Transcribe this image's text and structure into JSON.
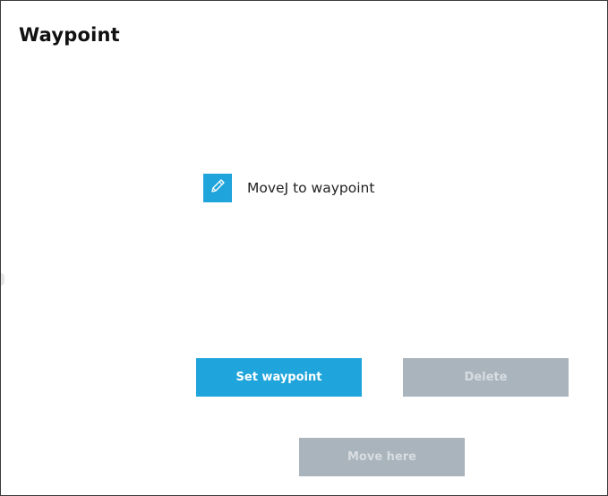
{
  "header": {
    "title": "Waypoint"
  },
  "waypoint": {
    "edit_icon": "pencil-icon",
    "label": "MoveJ to waypoint"
  },
  "buttons": {
    "set_waypoint": "Set waypoint",
    "delete": "Delete",
    "move_here": "Move here"
  },
  "colors": {
    "accent": "#1fa4db",
    "disabled": "#a9b4bd",
    "disabled_text": "#d8dde1",
    "border": "#3a3a3a"
  },
  "state": {
    "delete_enabled": false,
    "move_here_enabled": false
  }
}
